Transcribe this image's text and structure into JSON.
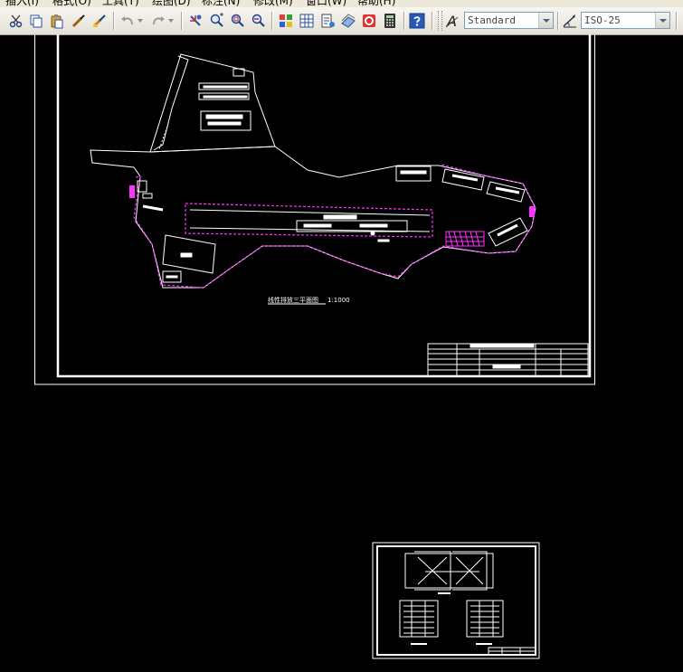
{
  "menubar": {
    "items": [
      {
        "label": "插入(I)"
      },
      {
        "label": "格式(O)"
      },
      {
        "label": "工具(T)"
      },
      {
        "label": "绘图(D)"
      },
      {
        "label": "标注(N)"
      },
      {
        "label": "修改(M)"
      },
      {
        "label": "窗口(W)"
      },
      {
        "label": "帮助(H)"
      }
    ]
  },
  "toolbar": {
    "text_style": {
      "value": "Standard"
    },
    "dim_style": {
      "value": "ISO-25"
    },
    "text_style_icon_glyph": "A"
  },
  "drawing": {
    "plan_title": "线性排放三平面图",
    "plan_scale": "1:1000"
  },
  "colors": {
    "background": "#000000",
    "lines": "#ffffff",
    "boundary": "#ff33ff",
    "toolbar": "#ece9d8"
  }
}
